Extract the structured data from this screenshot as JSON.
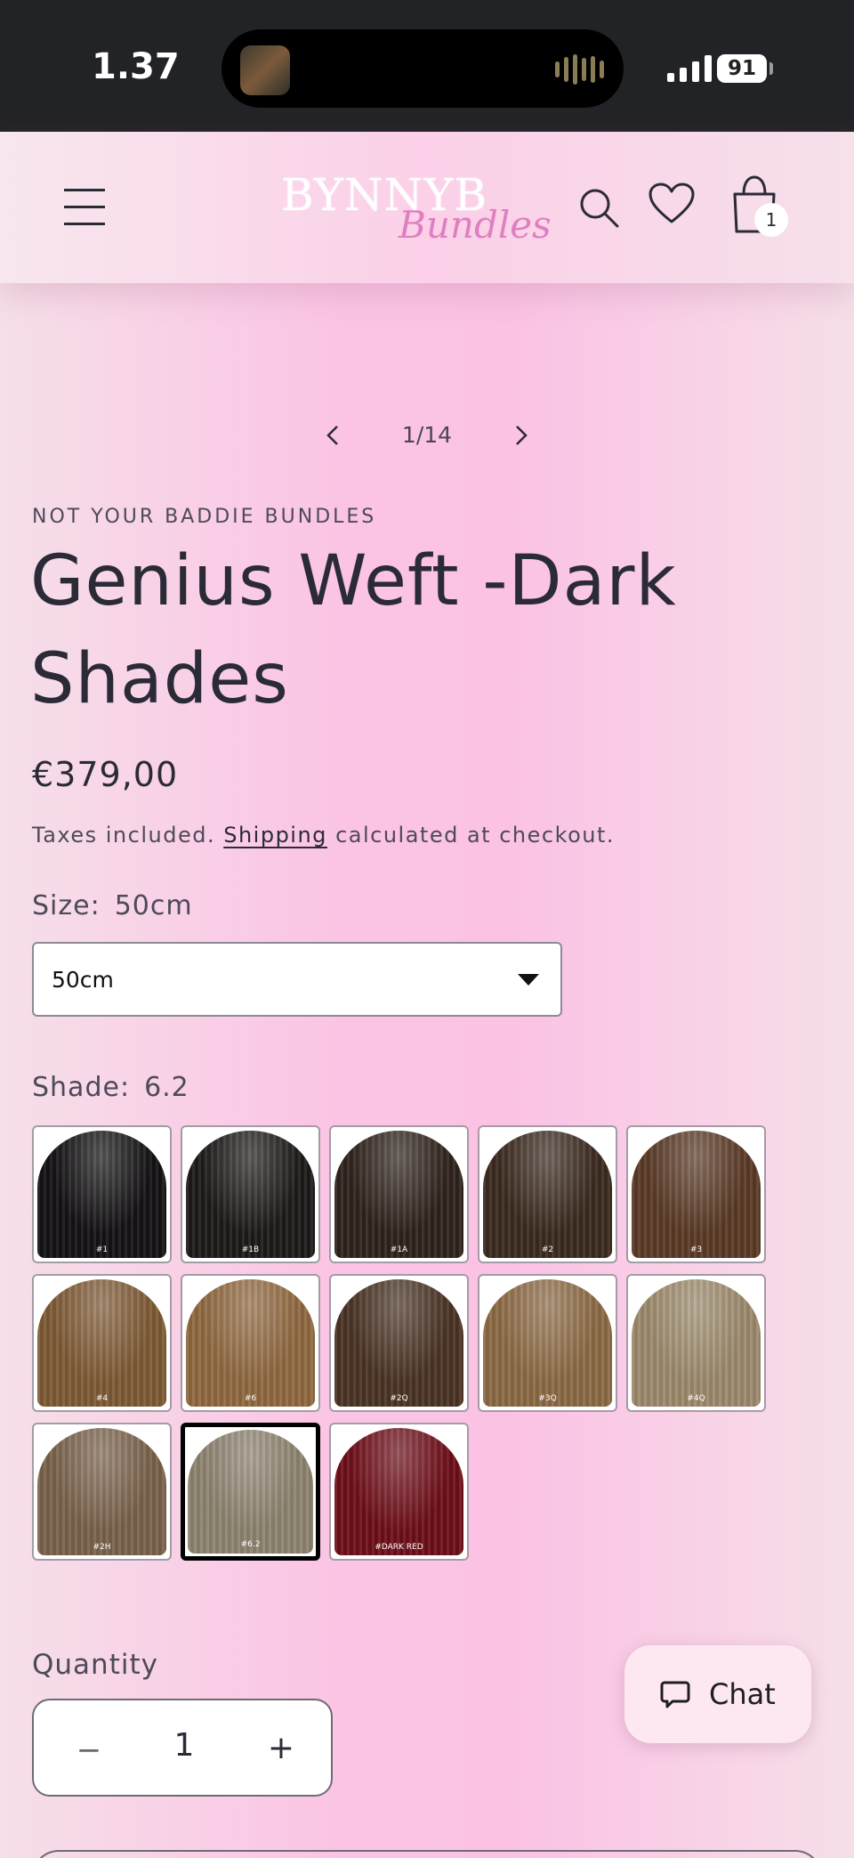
{
  "status_bar": {
    "time": "1.37",
    "battery": "91"
  },
  "header": {
    "logo_main": "BYNNYB",
    "logo_script": "Bundles",
    "cart_count": "1"
  },
  "gallery": {
    "counter": "1/14"
  },
  "product": {
    "vendor": "NOT YOUR BADDIE BUNDLES",
    "title": "Genius Weft -Dark Shades",
    "price": "€379,00",
    "taxes_prefix": "Taxes included.",
    "shipping_link": "Shipping",
    "taxes_suffix": "calculated at checkout."
  },
  "size": {
    "label": "Size:",
    "value": "50cm",
    "selected_option": "50cm"
  },
  "shade": {
    "label": "Shade:",
    "value": "6.2",
    "swatches": [
      {
        "code": "#1",
        "color": "#141214"
      },
      {
        "code": "#1B",
        "color": "#1e1a1a"
      },
      {
        "code": "#1A",
        "color": "#2f231c"
      },
      {
        "code": "#2",
        "color": "#3b2a1f"
      },
      {
        "code": "#3",
        "color": "#5a3a26"
      },
      {
        "code": "#4",
        "color": "#7e5a35"
      },
      {
        "code": "#6",
        "color": "#8f6840"
      },
      {
        "code": "#2Q",
        "color": "#4a3325"
      },
      {
        "code": "#3Q",
        "color": "#8c6a45"
      },
      {
        "code": "#4Q",
        "color": "#9c8a6c"
      },
      {
        "code": "#2H",
        "color": "#7a624c"
      },
      {
        "code": "#6.2",
        "color": "#8d8370"
      },
      {
        "code": "#DARK RED",
        "color": "#6e0f1a"
      }
    ],
    "selected_index": 11
  },
  "quantity": {
    "label": "Quantity",
    "value": "1",
    "minus": "−",
    "plus": "+"
  },
  "chat": {
    "label": "Chat"
  },
  "colors": {
    "accent_pink": "#fbc2e4",
    "text_dark": "#2b2a37",
    "logo_pink": "#e07fc0"
  }
}
